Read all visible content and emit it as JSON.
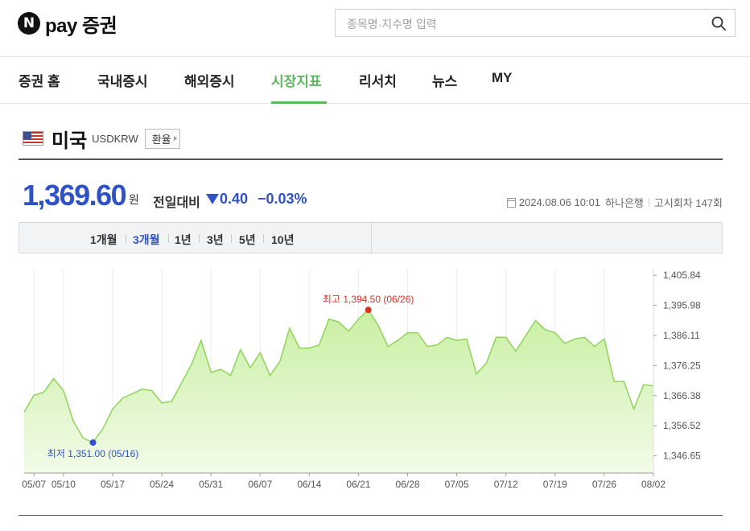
{
  "brand": {
    "name": "pay 증권",
    "n": "N"
  },
  "search": {
    "placeholder": "종목명·지수명 입력"
  },
  "nav": {
    "items": [
      {
        "label": "증권 홈"
      },
      {
        "label": "국내증시"
      },
      {
        "label": "해외증시"
      },
      {
        "label": "시장지표",
        "active": true
      },
      {
        "label": "리서치"
      },
      {
        "label": "뉴스"
      },
      {
        "label": "MY"
      }
    ]
  },
  "title": {
    "country": "미국",
    "code": "USDKRW",
    "fx_button": "환율"
  },
  "quote": {
    "price": "1,369.60",
    "unit": "원",
    "change_label": "전일대비",
    "change": "0.40",
    "change_pct": "−0.03%",
    "datetime": "2024.08.06 10:01",
    "bank": "하나은행",
    "notice": "고시회차 147회"
  },
  "period_tabs": [
    {
      "label": "1개월"
    },
    {
      "label": "3개월",
      "active": true
    },
    {
      "label": "1년"
    },
    {
      "label": "3년"
    },
    {
      "label": "5년"
    },
    {
      "label": "10년"
    }
  ],
  "colors": {
    "accent_green": "#5cb85c",
    "price_blue": "#3052c8",
    "high_red": "#d93025",
    "area_fill": "#d6f2b8",
    "area_line": "#8fd45a"
  },
  "chart_data": {
    "type": "area",
    "ylim": [
      1341.0,
      1408.0
    ],
    "yticks": [
      "1,405.84",
      "1,395.98",
      "1,386.11",
      "1,376.25",
      "1,366.38",
      "1,356.52",
      "1,346.65"
    ],
    "ytick_values": [
      1405.84,
      1395.98,
      1386.11,
      1376.25,
      1366.38,
      1356.52,
      1346.65
    ],
    "xticks": [
      "05/07",
      "05/10",
      "05/17",
      "05/24",
      "05/31",
      "06/07",
      "06/14",
      "06/21",
      "06/28",
      "07/05",
      "07/12",
      "07/19",
      "07/26",
      "08/02"
    ],
    "xtick_index": [
      1,
      4,
      9,
      14,
      19,
      24,
      29,
      34,
      39,
      44,
      49,
      54,
      59,
      64
    ],
    "values": [
      1361.0,
      1366.5,
      1367.5,
      1372.0,
      1368.0,
      1358.0,
      1352.5,
      1351.0,
      1355.5,
      1362.0,
      1365.5,
      1367.0,
      1368.5,
      1368.0,
      1364.0,
      1364.5,
      1370.5,
      1376.5,
      1384.5,
      1374.0,
      1375.0,
      1373.0,
      1381.5,
      1375.5,
      1380.5,
      1373.0,
      1377.5,
      1388.5,
      1382.0,
      1382.0,
      1383.0,
      1391.5,
      1390.5,
      1387.5,
      1391.5,
      1394.5,
      1389.5,
      1382.5,
      1384.5,
      1387.0,
      1387.0,
      1382.5,
      1383.0,
      1385.5,
      1384.5,
      1385.0,
      1373.5,
      1377.0,
      1385.5,
      1385.5,
      1381.0,
      1386.0,
      1391.0,
      1388.0,
      1387.0,
      1383.5,
      1385.0,
      1385.5,
      1382.5,
      1385.0,
      1371.0,
      1371.0,
      1362.0,
      1370.0,
      1369.6
    ],
    "high": {
      "label": "최고",
      "value": "1,394.50",
      "date": "(06/26)",
      "index": 35
    },
    "low": {
      "label": "최저",
      "value": "1,351.00",
      "date": "(05/16)",
      "index": 7
    }
  }
}
